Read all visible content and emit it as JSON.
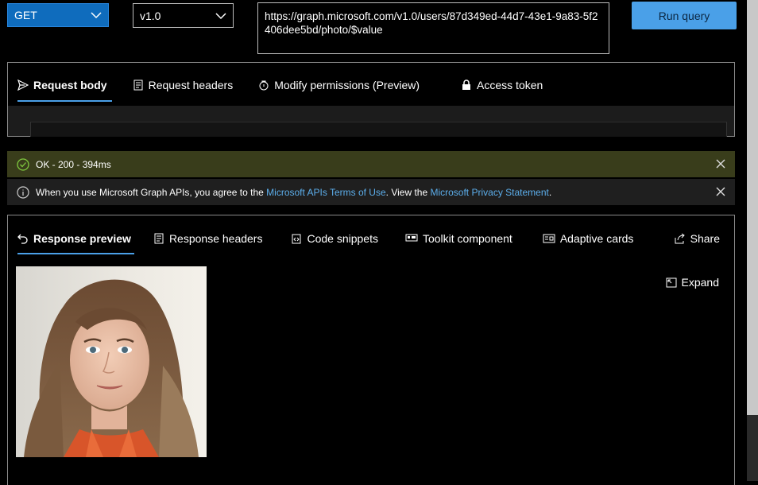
{
  "query": {
    "method": "GET",
    "version": "v1.0",
    "url": "https://graph.microsoft.com/v1.0/users/87d349ed-44d7-43e1-9a83-5f2406dee5bd/photo/$value",
    "run_label": "Run query"
  },
  "request_tabs": [
    {
      "label": "Request body",
      "icon": "send-icon",
      "active": true
    },
    {
      "label": "Request headers",
      "icon": "document-icon"
    },
    {
      "label": "Modify permissions (Preview)",
      "icon": "lock-shield-icon"
    },
    {
      "label": "Access token",
      "icon": "lock-icon"
    }
  ],
  "status": {
    "text": "OK - 200 - 394ms",
    "color": "#393d1b"
  },
  "terms": {
    "prefix": "When you use Microsoft Graph APIs, you agree to the ",
    "terms_link": "Microsoft APIs Terms of Use",
    "middle": ". View the ",
    "privacy_link": "Microsoft Privacy Statement",
    "suffix": "."
  },
  "response_tabs": [
    {
      "label": "Response preview",
      "icon": "undo-icon",
      "active": true
    },
    {
      "label": "Response headers",
      "icon": "document-icon"
    },
    {
      "label": "Code snippets",
      "icon": "code-icon"
    },
    {
      "label": "Toolkit component",
      "icon": "toolkit-icon"
    },
    {
      "label": "Adaptive cards",
      "icon": "card-icon"
    }
  ],
  "share_label": "Share",
  "expand_label": "Expand",
  "colors": {
    "accent": "#4aa0e8",
    "method_bg": "#0f6cbd",
    "link": "#5caeeb"
  }
}
